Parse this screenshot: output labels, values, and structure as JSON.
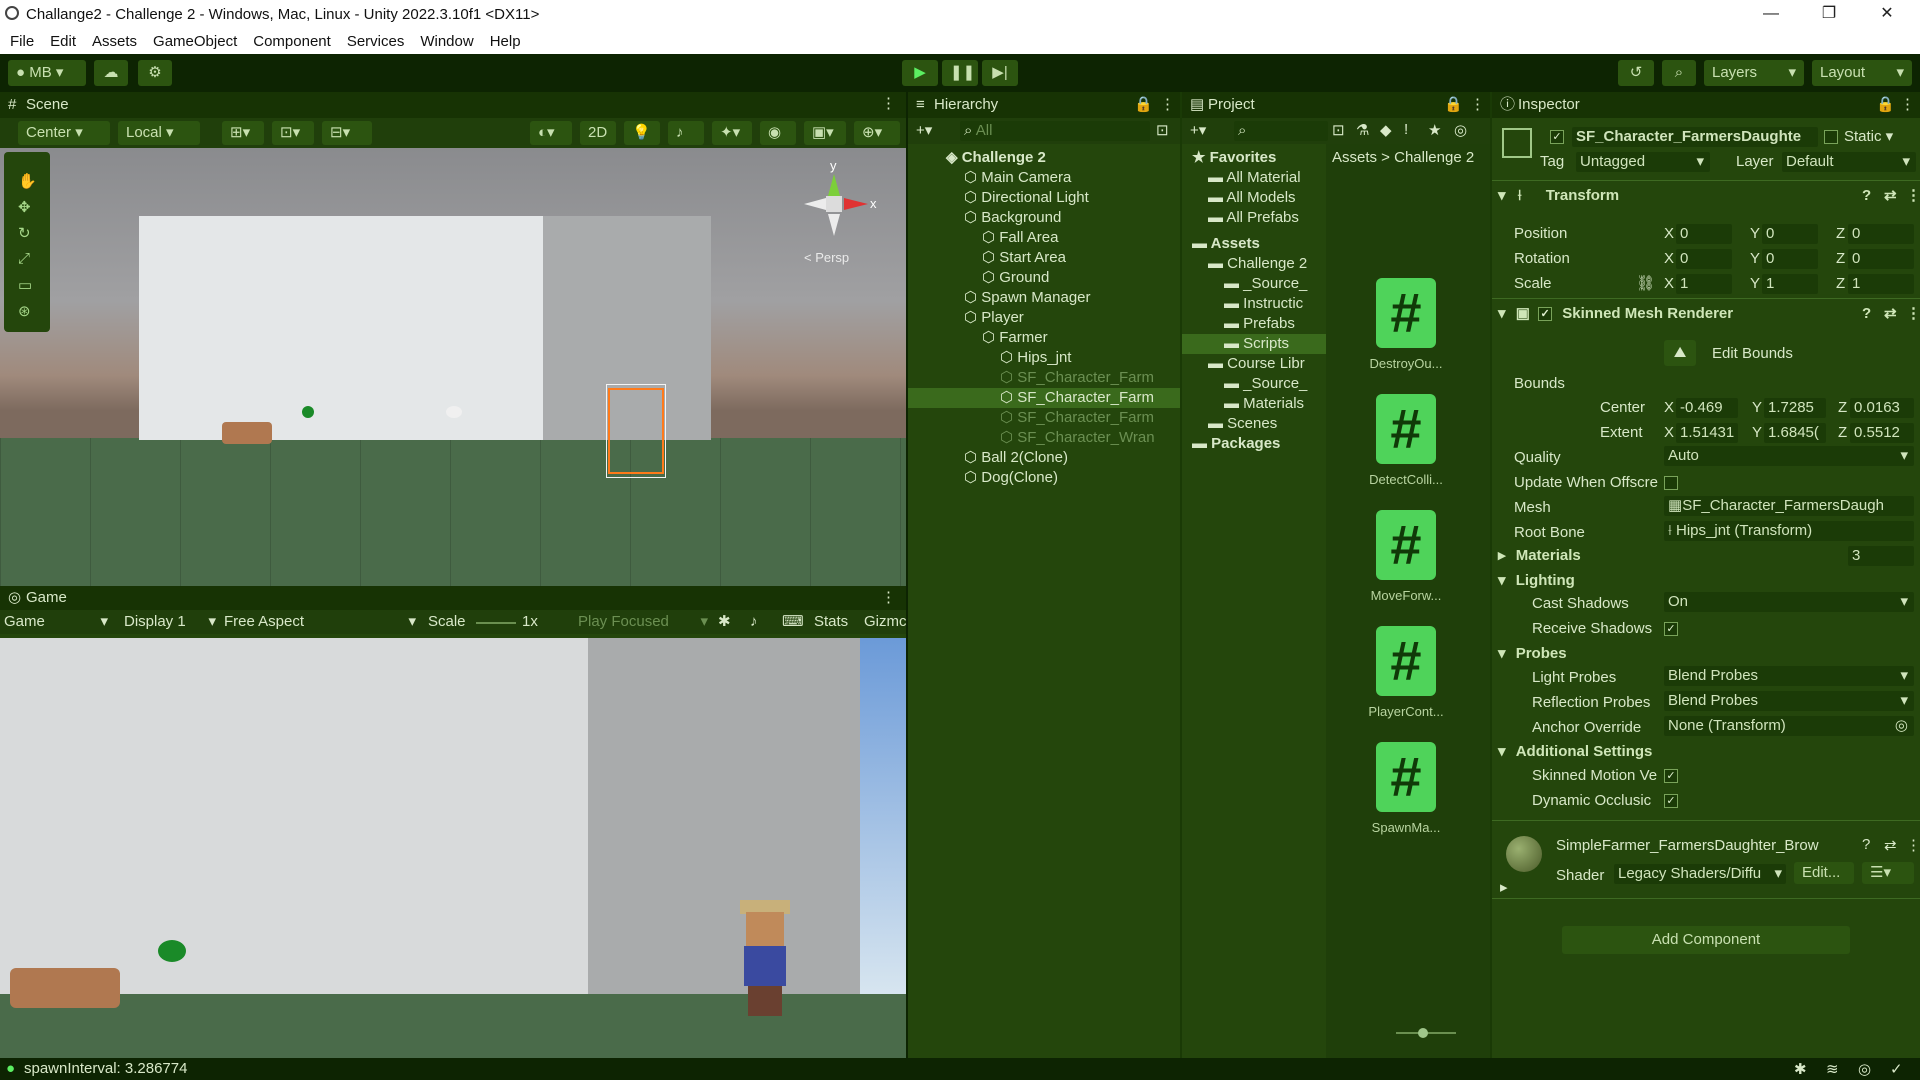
{
  "window": {
    "title": "Challange2 - Challenge 2 - Windows, Mac, Linux - Unity 2022.3.10f1 <DX11>",
    "minimize": "—",
    "maximize": "❐",
    "close": "✕"
  },
  "menu": [
    "File",
    "Edit",
    "Assets",
    "GameObject",
    "Component",
    "Services",
    "Window",
    "Help"
  ],
  "toolbar": {
    "account": "MB",
    "layers": "Layers",
    "layout": "Layout"
  },
  "scene": {
    "tab": "Scene",
    "pivot": "Center",
    "space": "Local",
    "mode2d": "2D",
    "persp": "< Persp",
    "axis_y": "y",
    "axis_x": "x"
  },
  "game": {
    "tab": "Game",
    "view": "Game",
    "display": "Display 1",
    "aspect": "Free Aspect",
    "scale_label": "Scale",
    "scale_value": "1x",
    "play_focused": "Play Focused",
    "stats": "Stats",
    "gizmos": "Gizmc"
  },
  "hierarchy": {
    "tab": "Hierarchy",
    "search_placeholder": "All",
    "items": [
      {
        "label": "Challenge 2",
        "indent": 0,
        "bold": true
      },
      {
        "label": "Main Camera",
        "indent": 1
      },
      {
        "label": "Directional Light",
        "indent": 1
      },
      {
        "label": "Background",
        "indent": 1
      },
      {
        "label": "Fall Area",
        "indent": 2
      },
      {
        "label": "Start Area",
        "indent": 2
      },
      {
        "label": "Ground",
        "indent": 2
      },
      {
        "label": "Spawn Manager",
        "indent": 1
      },
      {
        "label": "Player",
        "indent": 1
      },
      {
        "label": "Farmer",
        "indent": 2
      },
      {
        "label": "Hips_jnt",
        "indent": 3
      },
      {
        "label": "SF_Character_Farm",
        "indent": 3,
        "dim": true
      },
      {
        "label": "SF_Character_Farm",
        "indent": 3,
        "selected": true
      },
      {
        "label": "SF_Character_Farm",
        "indent": 3,
        "dim": true
      },
      {
        "label": "SF_Character_Wran",
        "indent": 3,
        "dim": true
      },
      {
        "label": "Ball 2(Clone)",
        "indent": 1
      },
      {
        "label": "Dog(Clone)",
        "indent": 1
      }
    ]
  },
  "project": {
    "tab": "Project",
    "breadcrumb": [
      "Assets",
      "Challenge 2"
    ],
    "tree": [
      {
        "label": "Favorites",
        "indent": 0,
        "bold": true
      },
      {
        "label": "All Material",
        "indent": 1
      },
      {
        "label": "All Models",
        "indent": 1
      },
      {
        "label": "All Prefabs",
        "indent": 1
      },
      {
        "label": "Assets",
        "indent": 0,
        "bold": true
      },
      {
        "label": "Challenge 2",
        "indent": 1
      },
      {
        "label": "_Source_",
        "indent": 2
      },
      {
        "label": "Instructic",
        "indent": 2
      },
      {
        "label": "Prefabs",
        "indent": 2
      },
      {
        "label": "Scripts",
        "indent": 2,
        "selected": true
      },
      {
        "label": "Course Libr",
        "indent": 1
      },
      {
        "label": "_Source_",
        "indent": 2
      },
      {
        "label": "Materials",
        "indent": 2
      },
      {
        "label": "Scenes",
        "indent": 1
      },
      {
        "label": "Packages",
        "indent": 0,
        "bold": true
      }
    ],
    "assets": [
      "DestroyOu...",
      "DetectColli...",
      "MoveForw...",
      "PlayerCont...",
      "SpawnMa..."
    ]
  },
  "inspector": {
    "tab": "Inspector",
    "object_name": "SF_Character_FarmersDaughte",
    "static": "Static",
    "tag_label": "Tag",
    "tag_value": "Untagged",
    "layer_label": "Layer",
    "layer_value": "Default",
    "transform": {
      "title": "Transform",
      "position": {
        "label": "Position",
        "x": "0",
        "y": "0",
        "z": "0"
      },
      "rotation": {
        "label": "Rotation",
        "x": "0",
        "y": "0",
        "z": "0"
      },
      "scale": {
        "label": "Scale",
        "x": "1",
        "y": "1",
        "z": "1"
      }
    },
    "smr": {
      "title": "Skinned Mesh Renderer",
      "edit_bounds": "Edit Bounds",
      "bounds": "Bounds",
      "center": {
        "label": "Center",
        "x": "-0.469",
        "y": "1.7285",
        "z": "0.0163"
      },
      "extent": {
        "label": "Extent",
        "x": "1.51431",
        "y": "1.6845(",
        "z": "0.5512"
      },
      "quality": {
        "label": "Quality",
        "value": "Auto"
      },
      "update_offscreen": "Update When Offscre",
      "mesh": {
        "label": "Mesh",
        "value": "SF_Character_FarmersDaugh"
      },
      "root_bone": {
        "label": "Root Bone",
        "value": "Hips_jnt (Transform)"
      },
      "materials": {
        "label": "Materials",
        "value": "3"
      },
      "lighting": "Lighting",
      "cast_shadows": {
        "label": "Cast Shadows",
        "value": "On"
      },
      "receive_shadows": "Receive Shadows",
      "probes": "Probes",
      "light_probes": {
        "label": "Light Probes",
        "value": "Blend Probes"
      },
      "reflection_probes": {
        "label": "Reflection Probes",
        "value": "Blend Probes"
      },
      "anchor_override": {
        "label": "Anchor Override",
        "value": "None (Transform)"
      },
      "additional": "Additional Settings",
      "skinned_motion": "Skinned Motion Ve",
      "dynamic_occlusion": "Dynamic Occlusic"
    },
    "material": {
      "name": "SimpleFarmer_FarmersDaughter_Brow",
      "shader_label": "Shader",
      "shader_value": "Legacy Shaders/Diffu",
      "edit": "Edit..."
    },
    "add_component": "Add Component"
  },
  "status": {
    "message": "spawnInterval: 3.286774"
  },
  "colors": {
    "accent": "#4fd35a",
    "selection_orange": "#ff7a1a"
  }
}
